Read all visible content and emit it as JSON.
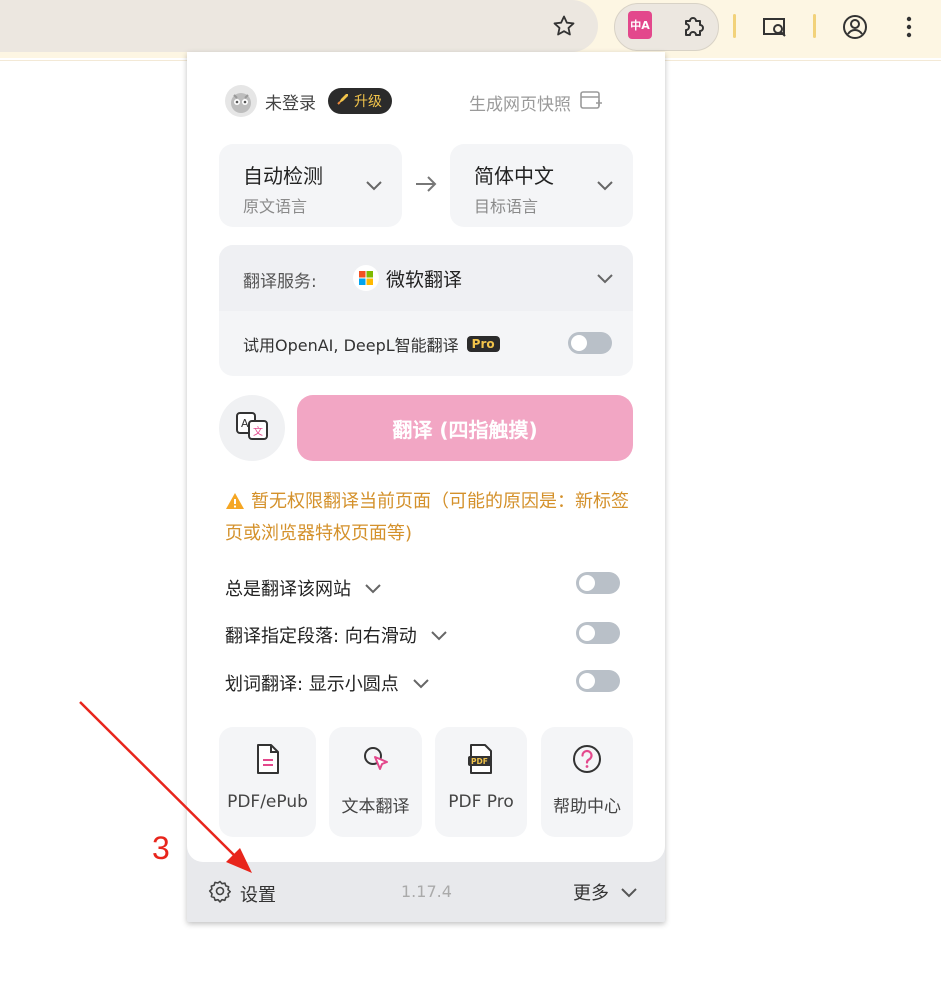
{
  "browser": {
    "icons": [
      "star-icon",
      "translate-extension-icon",
      "puzzle-icon",
      "tab-search-icon",
      "profile-icon",
      "kebab-menu-icon"
    ],
    "extension_badge": "中A"
  },
  "header": {
    "user_name": "未登录",
    "upgrade_label": "升级",
    "snapshot_label": "生成网页快照"
  },
  "languages": {
    "source": {
      "name": "自动检测",
      "caption": "原文语言"
    },
    "target": {
      "name": "简体中文",
      "caption": "目标语言"
    }
  },
  "service": {
    "label": "翻译服务:",
    "name": "微软翻译",
    "ai_trial_label": "试用OpenAI, DeepL智能翻译",
    "pro_badge": "Pro",
    "ai_trial_enabled": false
  },
  "actions": {
    "translate_button": "翻译 (四指触摸)"
  },
  "warning": {
    "text": "暂无权限翻译当前页面（可能的原因是：新标签页或浏览器特权页面等)"
  },
  "options": [
    {
      "label": "总是翻译该网站",
      "enabled": false
    },
    {
      "label": "翻译指定段落:  向右滑动",
      "enabled": false
    },
    {
      "label": "划词翻译:  显示小圆点",
      "enabled": false
    }
  ],
  "tools": [
    {
      "label": "PDF/ePub",
      "icon": "document-icon"
    },
    {
      "label": "文本翻译",
      "icon": "text-translate-cursor-icon"
    },
    {
      "label": "PDF Pro",
      "icon": "pdf-icon"
    },
    {
      "label": "帮助中心",
      "icon": "help-icon"
    }
  ],
  "footer": {
    "settings_label": "设置",
    "version": "1.17.4",
    "more_label": "更多"
  },
  "annotation": {
    "step_number": "3",
    "color": "#e8251c"
  },
  "colors": {
    "accent_pink": "#f2a6c4",
    "warning": "#d4912b",
    "toolbar_bg": "#fdf6e3"
  }
}
